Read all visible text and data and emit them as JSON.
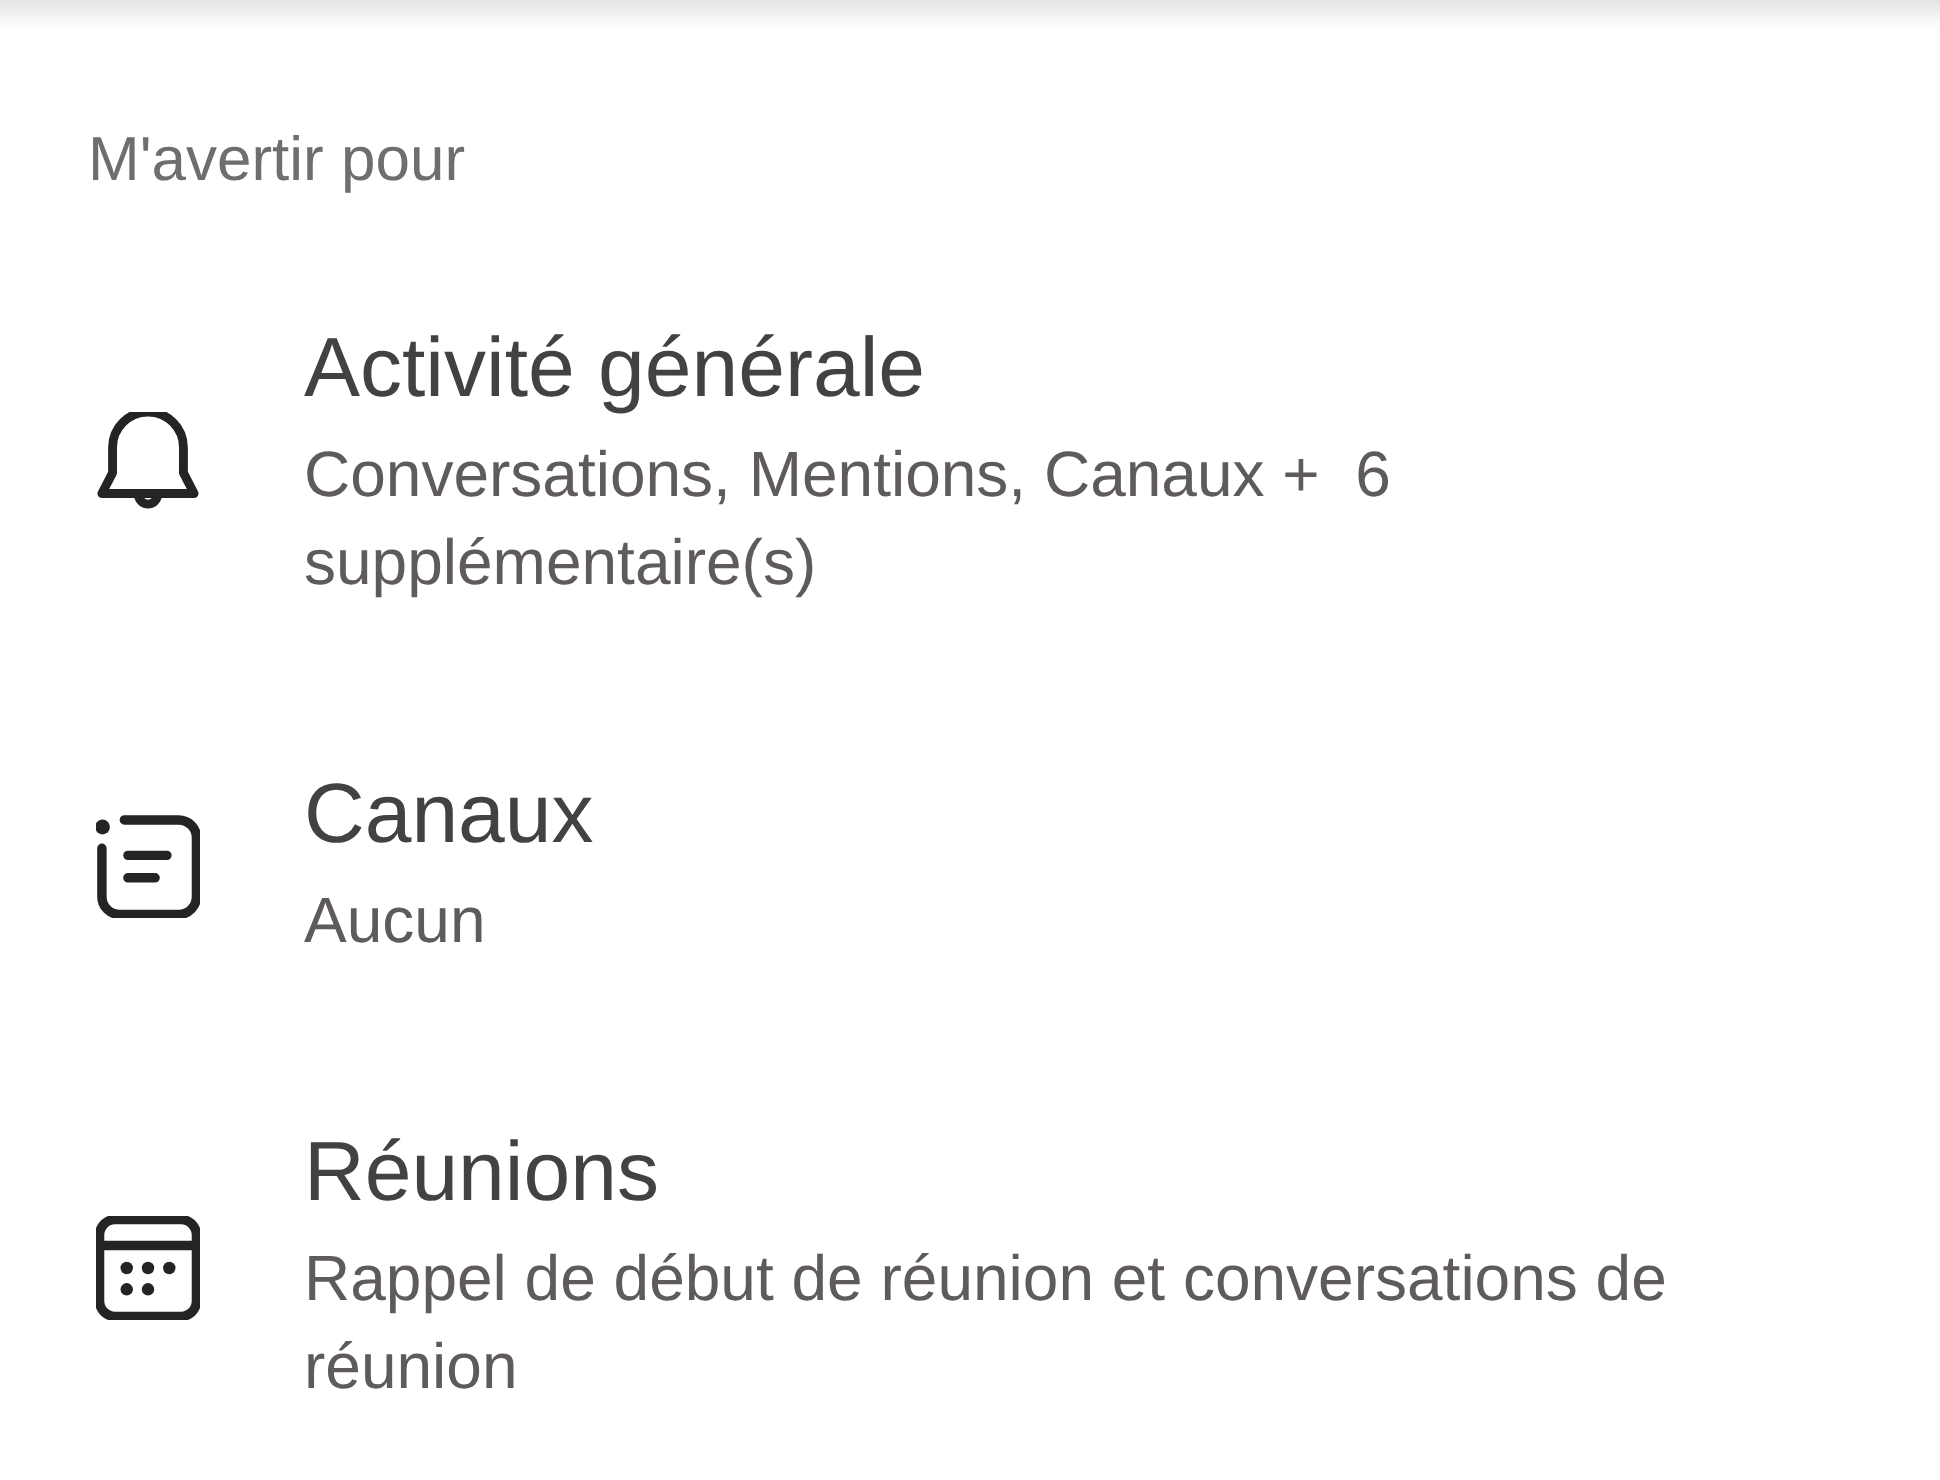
{
  "section": {
    "title": "M'avertir pour"
  },
  "items": [
    {
      "title": "Activité générale",
      "subtitle": "Conversations, Mentions, Canaux +  6 supplémentaire(s)"
    },
    {
      "title": "Canaux",
      "subtitle": "Aucun"
    },
    {
      "title": "Réunions",
      "subtitle": "Rappel de début de réunion et conversations de réunion"
    }
  ]
}
